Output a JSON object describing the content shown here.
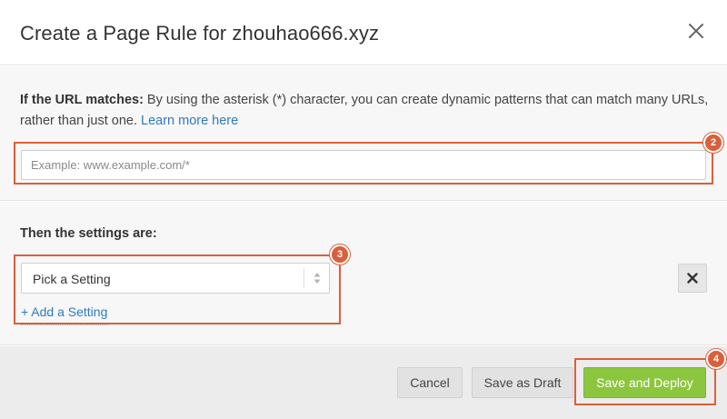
{
  "header": {
    "title": "Create a Page Rule for zhouhao666.xyz",
    "close_icon": "close-icon"
  },
  "url_section": {
    "label_bold": "If the URL matches:",
    "description": " By using the asterisk (*) character, you can create dynamic patterns that can match many URLs, rather than just one. ",
    "learn_more": "Learn more here",
    "input_value": "",
    "input_placeholder": "Example: www.example.com/*"
  },
  "settings_section": {
    "title": "Then the settings are:",
    "select_value": "Pick a Setting",
    "add_setting": "+ Add a Setting",
    "remove_icon": "times-icon"
  },
  "footer": {
    "cancel_label": "Cancel",
    "draft_label": "Save as Draft",
    "deploy_label": "Save and Deploy"
  },
  "annotations": [
    {
      "number": "2"
    },
    {
      "number": "3"
    },
    {
      "number": "4"
    }
  ],
  "colors": {
    "accent_green": "#8cc63f",
    "link_blue": "#2f7bbf",
    "annotation_red": "#d9603b",
    "panel_bg": "#f7f7f7",
    "footer_bg": "#ececec"
  }
}
